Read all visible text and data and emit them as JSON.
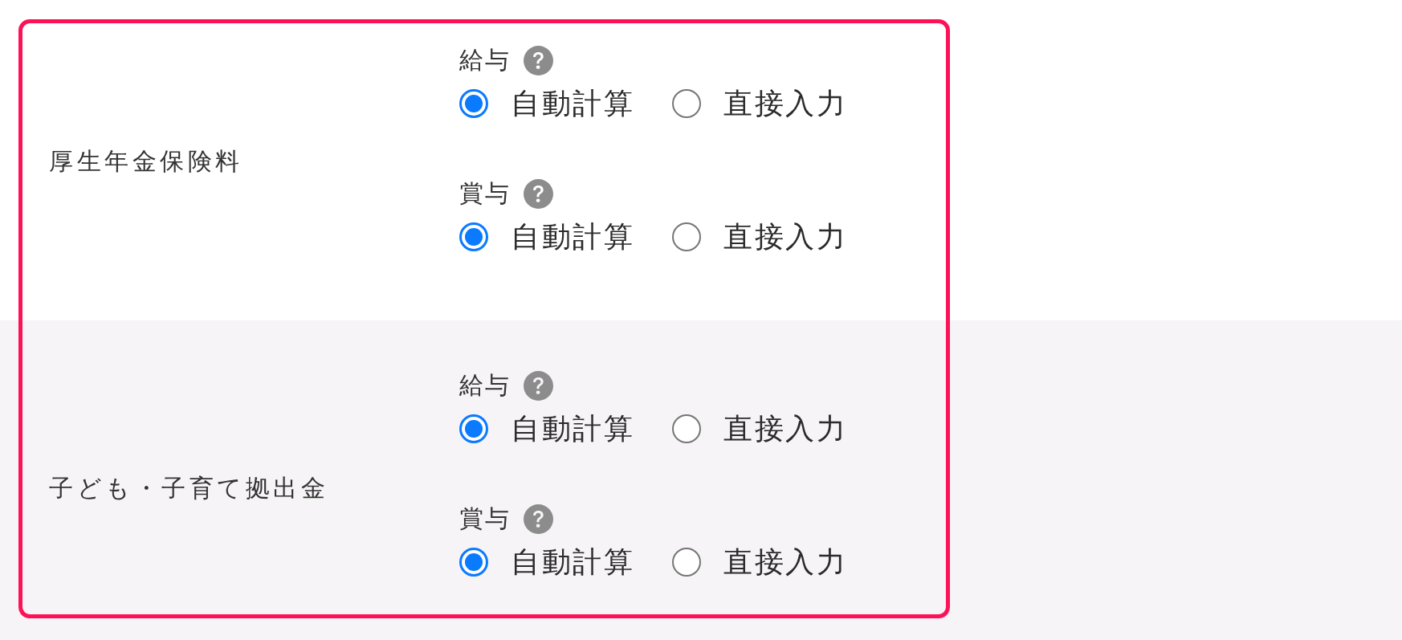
{
  "rows": [
    {
      "label": "厚生年金保険料",
      "shaded": false,
      "settings": [
        {
          "label": "給与",
          "options": [
            {
              "label": "自動計算",
              "selected": true
            },
            {
              "label": "直接入力",
              "selected": false
            }
          ]
        },
        {
          "label": "賞与",
          "options": [
            {
              "label": "自動計算",
              "selected": true
            },
            {
              "label": "直接入力",
              "selected": false
            }
          ]
        }
      ]
    },
    {
      "label": "子ども・子育て拠出金",
      "shaded": true,
      "settings": [
        {
          "label": "給与",
          "options": [
            {
              "label": "自動計算",
              "selected": true
            },
            {
              "label": "直接入力",
              "selected": false
            }
          ]
        },
        {
          "label": "賞与",
          "options": [
            {
              "label": "自動計算",
              "selected": true
            },
            {
              "label": "直接入力",
              "selected": false
            }
          ]
        }
      ]
    }
  ]
}
